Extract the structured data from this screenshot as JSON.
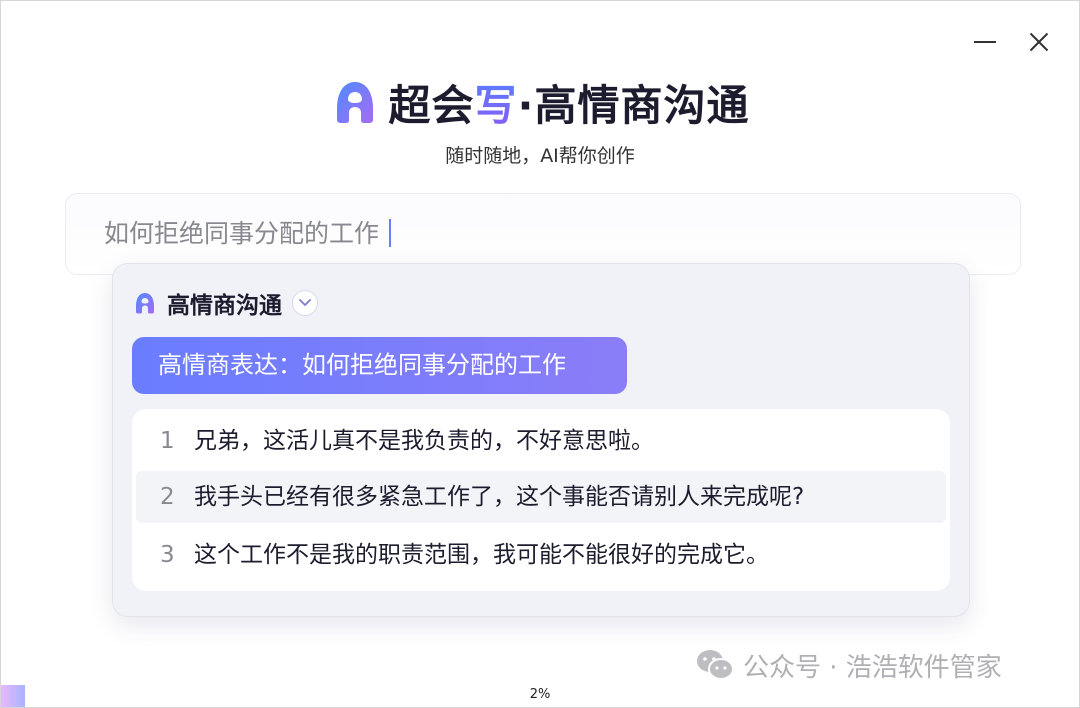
{
  "window": {
    "minimize_icon": "minimize-icon",
    "close_icon": "close-icon"
  },
  "brand": {
    "name_part1": "超会",
    "name_accent": "写",
    "name_part2": "·高情商沟通",
    "tagline": "随时随地，AI帮你创作",
    "logo_icon": "app-logo-icon",
    "accent_color": "#6a7dff"
  },
  "search": {
    "value": "如何拒绝同事分配的工作"
  },
  "panel": {
    "mode_title": "高情商沟通",
    "dropdown_icon": "chevron-down-icon",
    "prompt": "高情商表达：如何拒绝同事分配的工作",
    "results": [
      {
        "num": "1",
        "text": "兄弟，这活儿真不是我负责的，不好意思啦。"
      },
      {
        "num": "2",
        "text": "我手头已经有很多紧急工作了，这个事能否请别人来完成呢?"
      },
      {
        "num": "3",
        "text": "这个工作不是我的职责范围，我可能不能很好的完成它。"
      }
    ]
  },
  "watermark": {
    "text": "公众号 · 浩浩软件管家",
    "icon": "wechat-icon"
  },
  "footer": {
    "progress_text": "2%",
    "progress_value": 0.02
  }
}
